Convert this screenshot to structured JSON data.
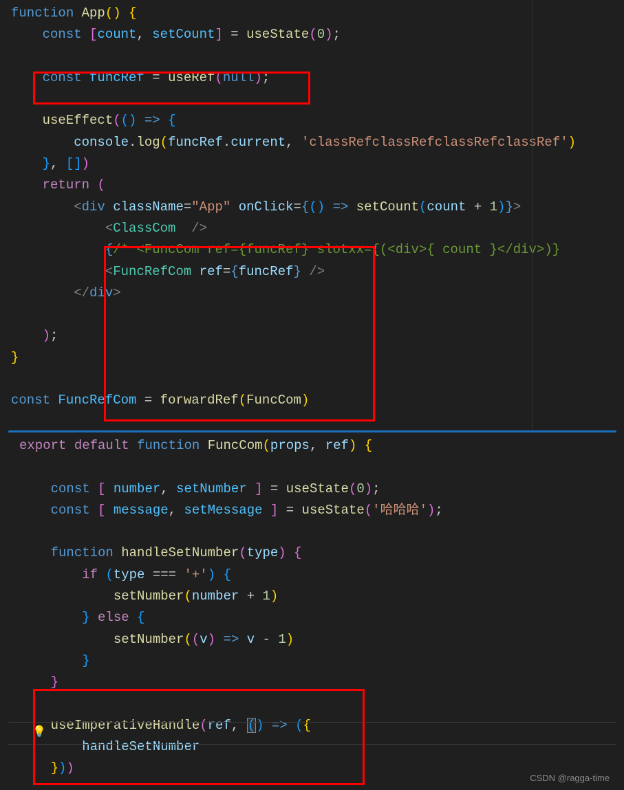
{
  "watermark": "CSDN @ragga-time",
  "code1": {
    "l1": {
      "fn": "function",
      "sp": " ",
      "App": "App",
      "p1": "(",
      "p2": ")",
      "sp2": " ",
      "b": "{"
    },
    "l2": {
      "kw": "const",
      "sp": " ",
      "b1": "[",
      "count": "count",
      "c": ", ",
      "setCount": "setCount",
      "b2": "]",
      "sp2": " ",
      "eq": "= ",
      "use": "useState",
      "p1": "(",
      "zero": "0",
      "p2": ")",
      "sc": ";"
    },
    "l3": {
      "kw": "const",
      "sp": " ",
      "funcRef": "funcRef",
      "sp2": " = ",
      "use": "useRef",
      "p1": "(",
      "null": "null",
      "p2": ")",
      "sc": ";"
    },
    "l4": {
      "use": "useEffect",
      "p1": "(",
      "p2": "(",
      "p3": ")",
      "sp": " ",
      "ar": "=>",
      "sp2": " ",
      "b": "{"
    },
    "l5": {
      "console": "console",
      "dot": ".",
      "log": "log",
      "p1": "(",
      "funcRef": "funcRef",
      "dot2": ".",
      "current": "current",
      "c": ", ",
      "str": "'classRefclassRefclassRefclassRef'",
      "p2": ")"
    },
    "l6": {
      "b": "}",
      "c": ", ",
      "b1": "[",
      "b2": "]",
      "p": ")"
    },
    "l7": {
      "return": "return",
      "sp": " ",
      "p": "("
    },
    "l8": {
      "lt": "<",
      "div": "div",
      "sp": " ",
      "cn": "className",
      "eq": "=",
      "str": "\"App\"",
      "sp2": " ",
      "oc": "onClick",
      "eq2": "=",
      "b1": "{",
      "p1": "(",
      "p2": ")",
      "sp3": " ",
      "ar": "=>",
      "sp4": " ",
      "setCount": "setCount",
      "p3": "(",
      "count": "count",
      "sp5": " ",
      "plus": "+",
      "sp6": " ",
      "one": "1",
      "p4": ")",
      "b2": "}",
      "gt": ">"
    },
    "l9": {
      "lt": "<",
      "ClassCom": "ClassCom",
      "sp": "  ",
      "sl": "/",
      "gt": ">"
    },
    "l10": {
      "b1": "{",
      "cmt": "/* <FuncCom ref={funcRef} slotxx={(<div>{ count }</div>)} ",
      "b2": ""
    },
    "l11": {
      "lt": "<",
      "FuncRefCom": "FuncRefCom",
      "sp": " ",
      "ref": "ref",
      "eq": "=",
      "b1": "{",
      "funcRef": "funcRef",
      "b2": "}",
      "sp2": " ",
      "sl": "/",
      "gt": ">"
    },
    "l12": {
      "lt": "</",
      "div": "div",
      "gt": ">"
    },
    "l13": {
      "p": ")",
      "sc": ";"
    },
    "l14": {
      "b": "}"
    },
    "l15": {
      "kw": "const",
      "sp": " ",
      "FuncRefCom": "FuncRefCom",
      "sp2": " = ",
      "fwd": "forwardRef",
      "p1": "(",
      "FuncCom": "FuncCom",
      "p2": ")"
    }
  },
  "code2": {
    "l1": {
      "ex": "export",
      "sp": " ",
      "df": "default",
      "sp2": " ",
      "fn": "function",
      "sp3": " ",
      "FuncCom": "FuncCom",
      "p1": "(",
      "props": "props",
      "c": ", ",
      "ref": "ref",
      "p2": ")",
      "sp4": " ",
      "b": "{"
    },
    "l2": {
      "kw": "const",
      "sp": " ",
      "b1": "[",
      "sp2": " ",
      "number": "number",
      "c": ", ",
      "setNumber": "setNumber",
      "sp3": " ",
      "b2": "]",
      "sp4": " = ",
      "use": "useState",
      "p1": "(",
      "zero": "0",
      "p2": ")",
      "sc": ";"
    },
    "l3": {
      "kw": "const",
      "sp": " ",
      "b1": "[",
      "sp2": " ",
      "message": "message",
      "c": ", ",
      "setMessage": "setMessage",
      "sp3": " ",
      "b2": "]",
      "sp4": " = ",
      "use": "useState",
      "p1": "(",
      "str": "'哈哈哈'",
      "p2": ")",
      "sc": ";"
    },
    "l4": {
      "fn": "function",
      "sp": " ",
      "h": "handleSetNumber",
      "p1": "(",
      "type": "type",
      "p2": ")",
      "sp2": " ",
      "b": "{"
    },
    "l5": {
      "if": "if",
      "sp": " ",
      "p1": "(",
      "type": "type",
      "sp2": " ",
      "eq": "===",
      "sp3": " ",
      "str": "'+'",
      "p2": ")",
      "sp4": " ",
      "b": "{"
    },
    "l6": {
      "setNumber": "setNumber",
      "p1": "(",
      "number": "number",
      "sp": " ",
      "plus": "+",
      "sp2": " ",
      "one": "1",
      "p2": ")"
    },
    "l7": {
      "b": "}",
      "sp": " ",
      "else": "else",
      "sp2": " ",
      "b2": "{"
    },
    "l8": {
      "setNumber": "setNumber",
      "p1": "(",
      "p2": "(",
      "v": "v",
      "p3": ")",
      "sp": " ",
      "ar": "=>",
      "sp2": " ",
      "v2": "v",
      "sp3": " ",
      "minus": "-",
      "sp4": " ",
      "one": "1",
      "p4": ")"
    },
    "l9": {
      "b": "}"
    },
    "l10": {
      "b": "}"
    },
    "l11": {
      "use": "useImperativeHandle",
      "p1": "(",
      "ref": "ref",
      "c": ", ",
      "p2": "(",
      "cur": ")",
      "sp": " ",
      "ar": "=>",
      "sp2": " ",
      "p3": "(",
      "b": "{"
    },
    "l12": {
      "h": "handleSetNumber"
    },
    "l13": {
      "b": "}",
      "p1": ")",
      "p2": ")"
    }
  }
}
